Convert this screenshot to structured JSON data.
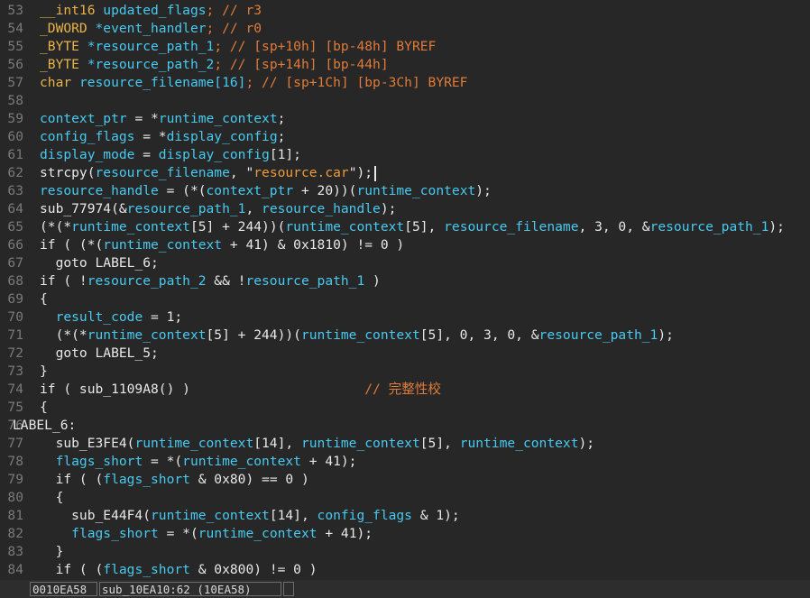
{
  "editor": {
    "lines": [
      {
        "n": "53",
        "tokens": [
          [
            "__int16 ",
            "t-type"
          ],
          [
            "updated_flags",
            "t-var"
          ],
          [
            "; // r3",
            "t-comment"
          ]
        ]
      },
      {
        "n": "54",
        "tokens": [
          [
            "_DWORD ",
            "t-type"
          ],
          [
            "*event_handler",
            "t-var"
          ],
          [
            "; // r0",
            "t-comment"
          ]
        ]
      },
      {
        "n": "55",
        "tokens": [
          [
            "_BYTE ",
            "t-type"
          ],
          [
            "*resource_path_1",
            "t-var"
          ],
          [
            "; // [sp+10h] [bp-48h] BYREF",
            "t-comment"
          ]
        ]
      },
      {
        "n": "56",
        "tokens": [
          [
            "_BYTE ",
            "t-type"
          ],
          [
            "*resource_path_2",
            "t-var"
          ],
          [
            "; // [sp+14h] [bp-44h]",
            "t-comment"
          ]
        ]
      },
      {
        "n": "57",
        "tokens": [
          [
            "char ",
            "t-type"
          ],
          [
            "resource_filename[16]",
            "t-var"
          ],
          [
            "; // [sp+1Ch] [bp-3Ch] BYREF",
            "t-comment"
          ]
        ]
      },
      {
        "n": "58",
        "tokens": []
      },
      {
        "n": "59",
        "tokens": [
          [
            "context_ptr",
            "t-var"
          ],
          [
            " = *",
            "t-text"
          ],
          [
            "runtime_context",
            "t-var"
          ],
          [
            ";",
            "t-text"
          ]
        ]
      },
      {
        "n": "60",
        "tokens": [
          [
            "config_flags",
            "t-var"
          ],
          [
            " = *",
            "t-text"
          ],
          [
            "display_config",
            "t-var"
          ],
          [
            ";",
            "t-text"
          ]
        ]
      },
      {
        "n": "61",
        "tokens": [
          [
            "display_mode",
            "t-var"
          ],
          [
            " = ",
            "t-text"
          ],
          [
            "display_config",
            "t-var"
          ],
          [
            "[1];",
            "t-text"
          ]
        ]
      },
      {
        "n": "62",
        "cursor": true,
        "tokens": [
          [
            "strcpy(",
            "t-text"
          ],
          [
            "resource_filename",
            "t-var"
          ],
          [
            ", \"",
            "t-text"
          ],
          [
            "resource.car",
            "t-str"
          ],
          [
            "\");",
            "t-text"
          ]
        ]
      },
      {
        "n": "63",
        "tokens": [
          [
            "resource_handle",
            "t-var"
          ],
          [
            " = (*(",
            "t-text"
          ],
          [
            "context_ptr",
            "t-var"
          ],
          [
            " + 20))(",
            "t-text"
          ],
          [
            "runtime_context",
            "t-var"
          ],
          [
            ");",
            "t-text"
          ]
        ]
      },
      {
        "n": "64",
        "tokens": [
          [
            "sub_77974(&",
            "t-text"
          ],
          [
            "resource_path_1",
            "t-var"
          ],
          [
            ", ",
            "t-text"
          ],
          [
            "resource_handle",
            "t-var"
          ],
          [
            ");",
            "t-text"
          ]
        ]
      },
      {
        "n": "65",
        "tokens": [
          [
            "(*(*",
            "t-text"
          ],
          [
            "runtime_context",
            "t-var"
          ],
          [
            "[5] + 244))(",
            "t-text"
          ],
          [
            "runtime_context",
            "t-var"
          ],
          [
            "[5], ",
            "t-text"
          ],
          [
            "resource_filename",
            "t-var"
          ],
          [
            ", 3, 0, &",
            "t-text"
          ],
          [
            "resource_path_1",
            "t-var"
          ],
          [
            ");",
            "t-text"
          ]
        ]
      },
      {
        "n": "66",
        "tokens": [
          [
            "if ( (*(",
            "t-text"
          ],
          [
            "runtime_context",
            "t-var"
          ],
          [
            " + 41) & 0x1810) != 0 )",
            "t-text"
          ]
        ]
      },
      {
        "n": "67",
        "tokens": [
          [
            "  goto LABEL_6;",
            "t-text"
          ]
        ]
      },
      {
        "n": "68",
        "tokens": [
          [
            "if ( !",
            "t-text"
          ],
          [
            "resource_path_2",
            "t-var"
          ],
          [
            " && !",
            "t-text"
          ],
          [
            "resource_path_1",
            "t-var"
          ],
          [
            " )",
            "t-text"
          ]
        ]
      },
      {
        "n": "69",
        "tokens": [
          [
            "{",
            "t-text"
          ]
        ]
      },
      {
        "n": "70",
        "tokens": [
          [
            "  ",
            "t-text"
          ],
          [
            "result_code",
            "t-var"
          ],
          [
            " = 1;",
            "t-text"
          ]
        ]
      },
      {
        "n": "71",
        "tokens": [
          [
            "  (*(*",
            "t-text"
          ],
          [
            "runtime_context",
            "t-var"
          ],
          [
            "[5] + 244))(",
            "t-text"
          ],
          [
            "runtime_context",
            "t-var"
          ],
          [
            "[5], 0, 3, 0, &",
            "t-text"
          ],
          [
            "resource_path_1",
            "t-var"
          ],
          [
            ");",
            "t-text"
          ]
        ]
      },
      {
        "n": "72",
        "tokens": [
          [
            "  goto LABEL_5;",
            "t-text"
          ]
        ]
      },
      {
        "n": "73",
        "tokens": [
          [
            "}",
            "t-text"
          ]
        ]
      },
      {
        "n": "74",
        "tokens": [
          [
            "if ( sub_1109A8() )",
            "t-text"
          ],
          [
            "                      // ",
            "t-comment"
          ],
          [
            "完整性校",
            "t-cn"
          ]
        ]
      },
      {
        "n": "75",
        "tokens": [
          [
            "{",
            "t-text"
          ]
        ]
      },
      {
        "n": "76",
        "label": true,
        "tokens": [
          [
            "LABEL_6:",
            "t-text"
          ]
        ]
      },
      {
        "n": "77",
        "tokens": [
          [
            "  sub_E3FE4(",
            "t-text"
          ],
          [
            "runtime_context",
            "t-var"
          ],
          [
            "[14], ",
            "t-text"
          ],
          [
            "runtime_context",
            "t-var"
          ],
          [
            "[5], ",
            "t-text"
          ],
          [
            "runtime_context",
            "t-var"
          ],
          [
            ");",
            "t-text"
          ]
        ]
      },
      {
        "n": "78",
        "tokens": [
          [
            "  ",
            "t-text"
          ],
          [
            "flags_short",
            "t-var"
          ],
          [
            " = *(",
            "t-text"
          ],
          [
            "runtime_context",
            "t-var"
          ],
          [
            " + 41);",
            "t-text"
          ]
        ]
      },
      {
        "n": "79",
        "tokens": [
          [
            "  if ( (",
            "t-text"
          ],
          [
            "flags_short",
            "t-var"
          ],
          [
            " & 0x80) == 0 )",
            "t-text"
          ]
        ]
      },
      {
        "n": "80",
        "tokens": [
          [
            "  {",
            "t-text"
          ]
        ]
      },
      {
        "n": "81",
        "tokens": [
          [
            "    sub_E44F4(",
            "t-text"
          ],
          [
            "runtime_context",
            "t-var"
          ],
          [
            "[14], ",
            "t-text"
          ],
          [
            "config_flags",
            "t-var"
          ],
          [
            " & 1);",
            "t-text"
          ]
        ]
      },
      {
        "n": "82",
        "tokens": [
          [
            "    ",
            "t-text"
          ],
          [
            "flags_short",
            "t-var"
          ],
          [
            " = *(",
            "t-text"
          ],
          [
            "runtime_context",
            "t-var"
          ],
          [
            " + 41);",
            "t-text"
          ]
        ]
      },
      {
        "n": "83",
        "tokens": [
          [
            "  }",
            "t-text"
          ]
        ]
      },
      {
        "n": "84",
        "tokens": [
          [
            "  if ( (",
            "t-text"
          ],
          [
            "flags_short",
            "t-var"
          ],
          [
            " & 0x800) != 0 )",
            "t-text"
          ]
        ]
      }
    ]
  },
  "statusbar": {
    "address": "0010EA58",
    "location": "sub_10EA10:62 (10EA58)"
  },
  "colors": {
    "background": "#272727",
    "variable": "#48c9ef",
    "type": "#e8b34a",
    "string": "#ee9a3c",
    "comment": "#e07b3a",
    "text": "#e8e8e8",
    "line_number": "#7a7a7a"
  }
}
